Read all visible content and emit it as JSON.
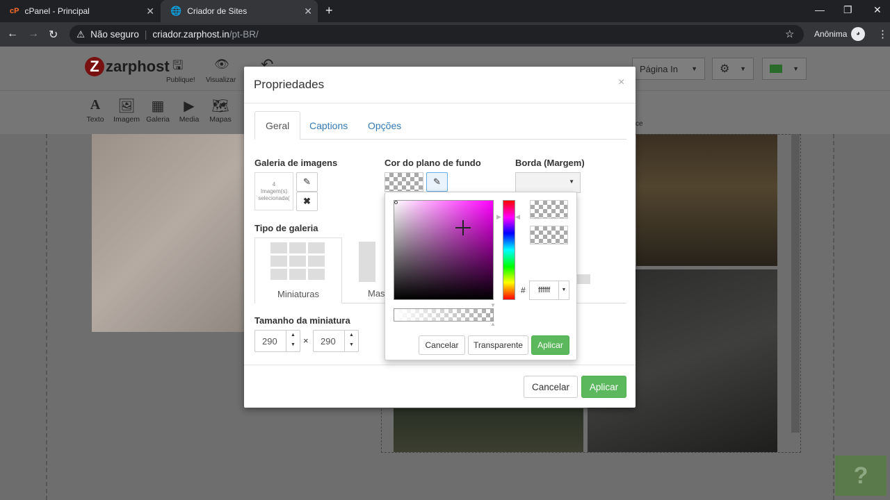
{
  "browser": {
    "tabs": [
      {
        "title": "cPanel - Principal",
        "icon": "cpanel-icon"
      },
      {
        "title": "Criador de Sites",
        "icon": "globe-icon"
      }
    ],
    "security_label": "Não seguro",
    "url_host": "criador.zarphost.in",
    "url_path": "/pt-BR/",
    "profile_label": "Anônima"
  },
  "app": {
    "logo": "zarphost",
    "toolbar": {
      "publish_label": "Publique!",
      "view_label": "Visualizar",
      "page_select": "Página In"
    },
    "tools": [
      {
        "label": "Texto",
        "icon": "A"
      },
      {
        "label": "Imagem",
        "icon": "🖼"
      },
      {
        "label": "Galeria",
        "icon": "▦"
      },
      {
        "label": "Media",
        "icon": "▶"
      },
      {
        "label": "Mapas",
        "icon": "🗺"
      }
    ],
    "partial_tool_label": "ce",
    "help_label": "?"
  },
  "modal": {
    "title": "Propriedades",
    "close": "×",
    "tabs": [
      "Geral",
      "Captions",
      "Opções"
    ],
    "gallery_label": "Galeria de imagens",
    "gallery_count": "4",
    "gallery_text1": "Imagem(s)",
    "gallery_text2": "selecionada(",
    "bg_color_label": "Cor do plano de fundo",
    "border_label": "Borda (Margem)",
    "gallery_type_label": "Tipo de galeria",
    "gallery_types": [
      "Miniaturas",
      "Mas"
    ],
    "thumb_size_label": "Tamanho da miniatura",
    "thumb_width": "290",
    "thumb_height": "290",
    "times": "×",
    "cancel_label": "Cancelar",
    "apply_label": "Aplicar"
  },
  "colorpicker": {
    "hash": "#",
    "hex_value": "ffffff",
    "cancel_label": "Cancelar",
    "transparent_label": "Transparente",
    "apply_label": "Aplicar",
    "hue_color": "#ff00ff"
  }
}
